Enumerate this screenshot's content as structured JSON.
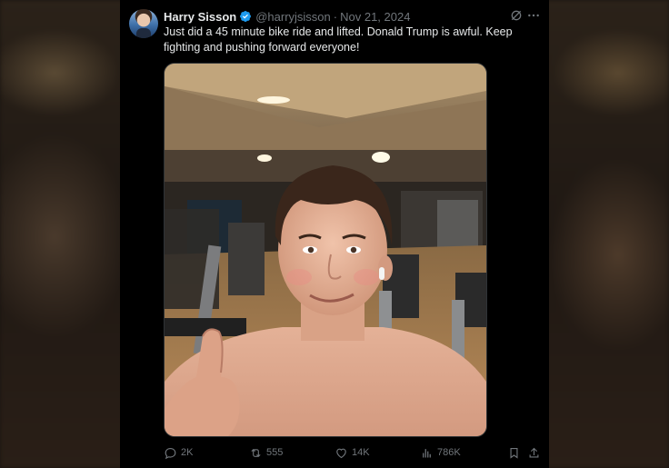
{
  "tweet": {
    "author_name": "Harry Sisson",
    "handle": "@harryjsisson",
    "separator": "·",
    "date": "Nov 21, 2024",
    "text": "Just did a 45 minute bike ride and lifted. Donald Trump is awful. Keep fighting and pushing forward everyone!",
    "verified": true
  },
  "header_icons": [
    "grok-icon",
    "more-icon"
  ],
  "actions": {
    "replies": "2K",
    "reposts": "555",
    "likes": "14K",
    "views": "786K"
  },
  "colors": {
    "card_bg": "#000000",
    "text_primary": "#e7e9ea",
    "text_secondary": "#71767b",
    "verified_blue": "#1d9bf0"
  }
}
